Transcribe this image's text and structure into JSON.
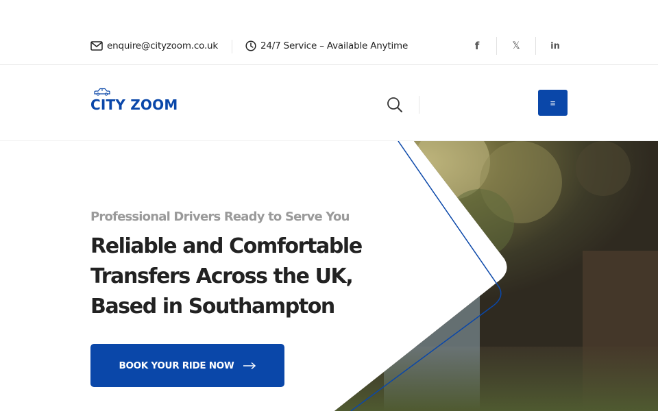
{
  "topbar": {
    "email": "enquire@cityzoom.co.uk",
    "hours": "24/7 Service – Available Anytime",
    "social": [
      {
        "name": "facebook",
        "icon": "facebook-icon",
        "glyph": "f"
      },
      {
        "name": "x",
        "icon": "x-icon",
        "glyph": "𝕏"
      },
      {
        "name": "linkedin",
        "icon": "linkedin-icon",
        "glyph": "in"
      }
    ]
  },
  "header": {
    "logo_text": "CITY ZOOM",
    "search_icon": "search-icon",
    "menu_glyph": "≡",
    "menu_icon": "hamburger-menu-icon"
  },
  "hero": {
    "eyebrow": "Professional Drivers Ready to Serve You",
    "title_lines": [
      "Reliable and Comfortable",
      "Transfers Across the UK,",
      "Based in Southampton"
    ],
    "cta_label": "BOOK YOUR RIDE NOW",
    "cta_icon": "arrow-right-icon"
  },
  "colors": {
    "brand": "#0a47a9",
    "text": "#222222",
    "muted": "#9a9a9a"
  }
}
